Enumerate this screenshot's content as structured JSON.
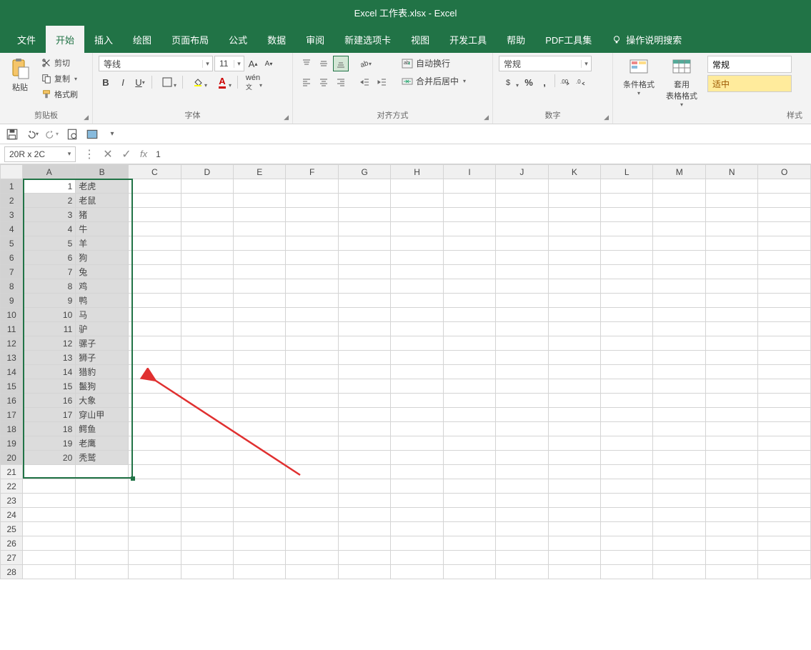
{
  "app": {
    "title": "Excel 工作表.xlsx - Excel"
  },
  "tabs": {
    "file": "文件",
    "home": "开始",
    "insert": "插入",
    "draw": "绘图",
    "layout": "页面布局",
    "formulas": "公式",
    "data": "数据",
    "review": "审阅",
    "newtab": "新建选项卡",
    "view": "视图",
    "devtools": "开发工具",
    "help": "帮助",
    "pdf": "PDF工具集",
    "tellme": "操作说明搜索"
  },
  "ribbon": {
    "clipboard": {
      "paste": "粘贴",
      "cut": "剪切",
      "copy": "复制",
      "painter": "格式刷",
      "group": "剪贴板"
    },
    "font": {
      "name": "等线",
      "size": "11",
      "group": "字体"
    },
    "alignment": {
      "wrap": "自动换行",
      "merge": "合并后居中",
      "group": "对齐方式"
    },
    "number": {
      "format": "常规",
      "group": "数字"
    },
    "styles": {
      "cond": "条件格式",
      "table": "套用\n表格格式",
      "normal": "常规",
      "good": "适中",
      "group": "样式"
    }
  },
  "namebox": "20R x 2C",
  "formula": "1",
  "columns": [
    "A",
    "B",
    "C",
    "D",
    "E",
    "F",
    "G",
    "H",
    "I",
    "J",
    "K",
    "L",
    "M",
    "N",
    "O"
  ],
  "column_widths": {
    "A": 76,
    "B": 76,
    "default": 76
  },
  "selected_cols": [
    "A",
    "B"
  ],
  "rows": 28,
  "selected_rows_end": 20,
  "active_cell": "A1",
  "cells": [
    {
      "a": 1,
      "b": "老虎"
    },
    {
      "a": 2,
      "b": "老鼠"
    },
    {
      "a": 3,
      "b": "猪"
    },
    {
      "a": 4,
      "b": "牛"
    },
    {
      "a": 5,
      "b": "羊"
    },
    {
      "a": 6,
      "b": "狗"
    },
    {
      "a": 7,
      "b": "兔"
    },
    {
      "a": 8,
      "b": "鸡"
    },
    {
      "a": 9,
      "b": "鸭"
    },
    {
      "a": 10,
      "b": "马"
    },
    {
      "a": 11,
      "b": "驴"
    },
    {
      "a": 12,
      "b": "骡子"
    },
    {
      "a": 13,
      "b": "狮子"
    },
    {
      "a": 14,
      "b": "猎豹"
    },
    {
      "a": 15,
      "b": "鬣狗"
    },
    {
      "a": 16,
      "b": "大象"
    },
    {
      "a": 17,
      "b": "穿山甲"
    },
    {
      "a": 18,
      "b": "鳄鱼"
    },
    {
      "a": 19,
      "b": "老鹰"
    },
    {
      "a": 20,
      "b": "秃鹫"
    }
  ]
}
